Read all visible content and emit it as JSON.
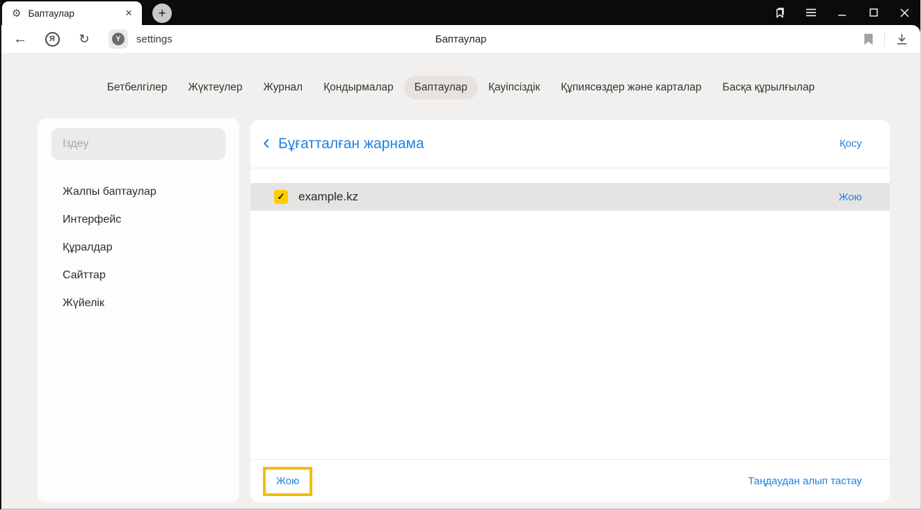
{
  "window": {
    "tab": {
      "title": "Баптаулар"
    }
  },
  "toolbar": {
    "url_text": "settings",
    "page_title": "Баптаулар"
  },
  "nav": {
    "tabs": [
      {
        "label": "Бетбелгілер",
        "active": false
      },
      {
        "label": "Жүктеулер",
        "active": false
      },
      {
        "label": "Журнал",
        "active": false
      },
      {
        "label": "Қондырмалар",
        "active": false
      },
      {
        "label": "Баптаулар",
        "active": true
      },
      {
        "label": "Қауіпсіздік",
        "active": false
      },
      {
        "label": "Құпиясөздер және карталар",
        "active": false
      },
      {
        "label": "Басқа құрылғылар",
        "active": false
      }
    ]
  },
  "sidebar": {
    "search_placeholder": "Іздеу",
    "items": [
      {
        "label": "Жалпы баптаулар"
      },
      {
        "label": "Интерфейс"
      },
      {
        "label": "Құралдар"
      },
      {
        "label": "Сайттар"
      },
      {
        "label": "Жүйелік"
      }
    ]
  },
  "main": {
    "title": "Бұғатталған жарнама",
    "add_label": "Қосу",
    "rows": [
      {
        "site": "example.kz",
        "checked": true,
        "action_label": "Жою"
      }
    ],
    "footer": {
      "delete_label": "Жою",
      "unselect_label": "Таңдаудан алып тастау"
    }
  },
  "icons": {
    "gear": "⚙",
    "tab_close": "×",
    "plus": "+",
    "back": "←",
    "refresh": "↻",
    "yandex_letter": "Я",
    "protect_letter": "Y",
    "chevron_left": "‹",
    "check": "✓"
  },
  "colors": {
    "accent_blue": "#1e82e0",
    "checkbox_yellow": "#ffcc00",
    "highlight_yellow": "#f4be00",
    "titlebar_black": "#0b0b0b",
    "page_background": "#f1f0ee",
    "selected_row_gray": "#e6e4e2"
  }
}
